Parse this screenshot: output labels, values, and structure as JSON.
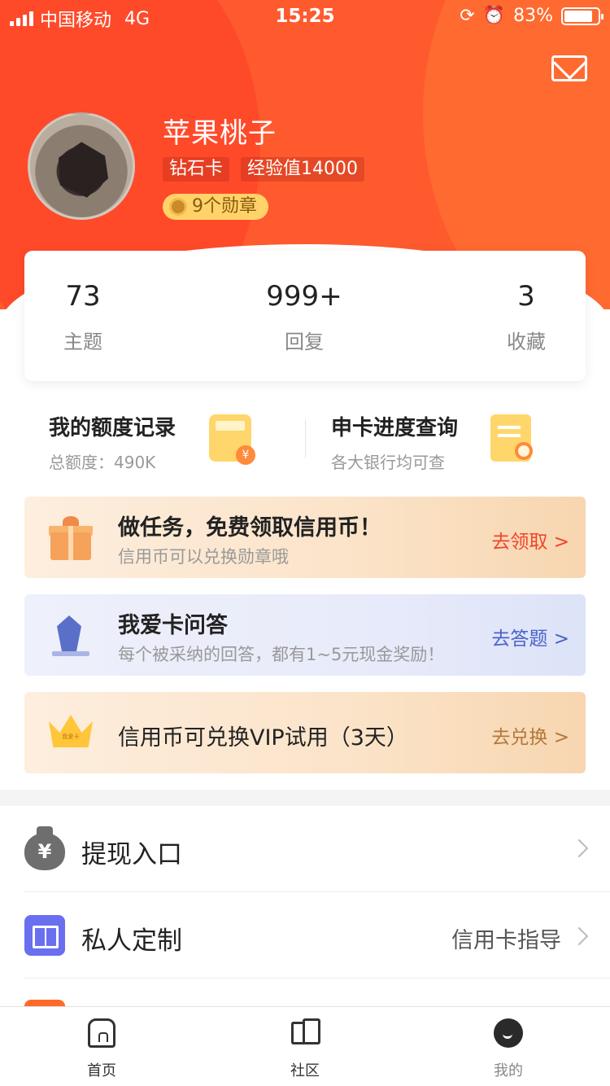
{
  "status_bar": {
    "carrier": "中国移动",
    "network": "4G",
    "time": "15:25",
    "battery": "83%"
  },
  "profile": {
    "name": "苹果桃子",
    "card_level": "钻石卡",
    "experience": "经验值14000",
    "medals": "9个勋章"
  },
  "stats": [
    {
      "value": "73",
      "label": "主题"
    },
    {
      "value": "999+",
      "label": "回复"
    },
    {
      "value": "3",
      "label": "收藏"
    }
  ],
  "quick_links": {
    "quota": {
      "title": "我的额度记录",
      "subtitle": "总额度：490K",
      "icon": "calculator-icon"
    },
    "progress": {
      "title": "申卡进度查询",
      "subtitle": "各大银行均可查",
      "icon": "document-search-icon"
    }
  },
  "banners": {
    "task": {
      "title": "做任务，免费领取信用币！",
      "subtitle": "信用币可以兑换勋章哦",
      "action": "去领取 >",
      "action_color": "#f0452a"
    },
    "qa": {
      "title": "我爱卡问答",
      "subtitle": "每个被采纳的回答，都有1~5元现金奖励！",
      "action": "去答题 >",
      "action_color": "#4a63c8"
    },
    "vip": {
      "title": "信用币可兑换VIP试用（3天）",
      "action": "去兑换 >",
      "action_color": "#b3783a",
      "crown_text": "我爱卡"
    }
  },
  "menu": [
    {
      "label": "提现入口",
      "right": "",
      "icon": "money-bag-icon"
    },
    {
      "label": "私人定制",
      "right": "信用卡指导",
      "icon": "book-icon"
    }
  ],
  "tabbar": [
    {
      "label": "首页",
      "icon": "home-icon"
    },
    {
      "label": "社区",
      "icon": "community-icon"
    },
    {
      "label": "我的",
      "icon": "mine-icon"
    }
  ],
  "colors": {
    "header": "#ff5a2e",
    "accent_orange": "#f0452a",
    "accent_blue": "#4a63c8",
    "medal_bg": "#ffd36a"
  }
}
